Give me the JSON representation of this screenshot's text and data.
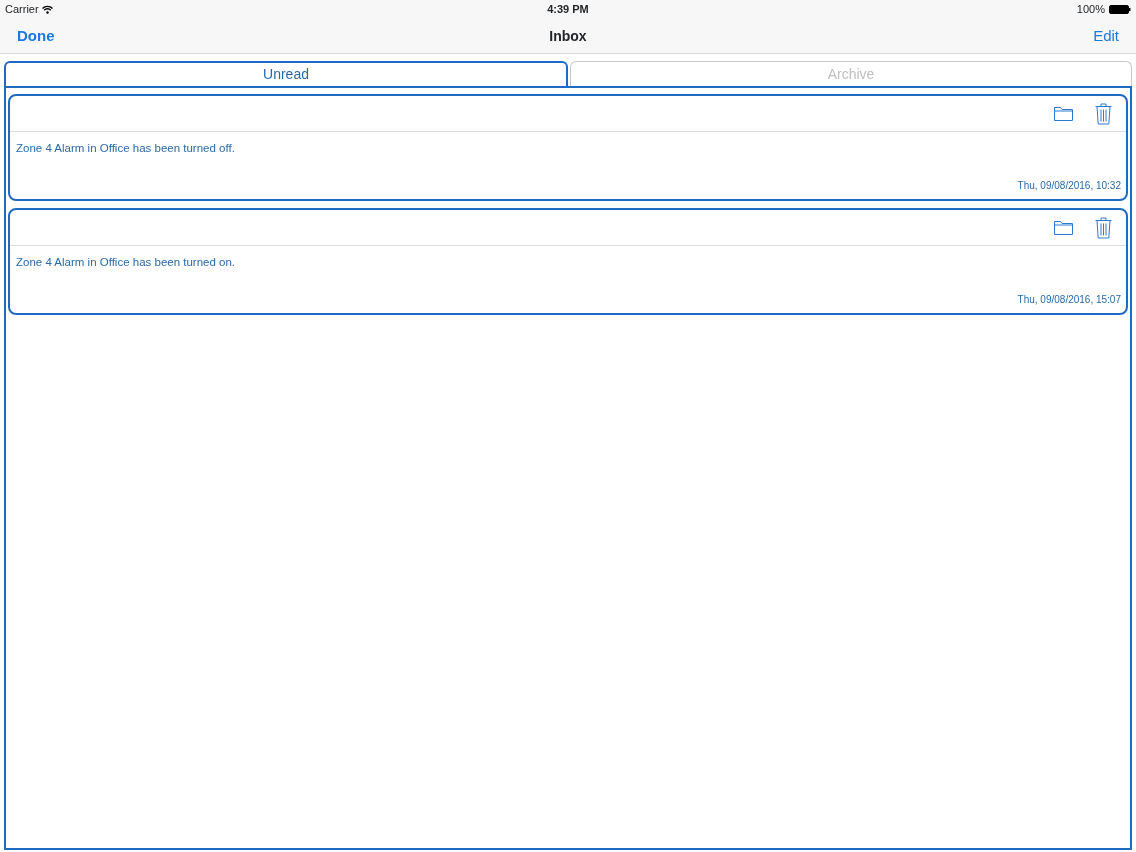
{
  "status_bar": {
    "carrier": "Carrier",
    "time": "4:39 PM",
    "battery": "100%"
  },
  "nav": {
    "left": "Done",
    "title": "Inbox",
    "right": "Edit"
  },
  "tabs": [
    {
      "label": "Unread",
      "selected": true
    },
    {
      "label": "Archive",
      "selected": false
    }
  ],
  "messages": [
    {
      "text": "Zone 4 Alarm in Office has been turned off.",
      "date": "Thu, 09/08/2016, 10:32"
    },
    {
      "text": "Zone 4 Alarm in Office has been turned on.",
      "date": "Thu, 09/08/2016, 15:07"
    }
  ]
}
